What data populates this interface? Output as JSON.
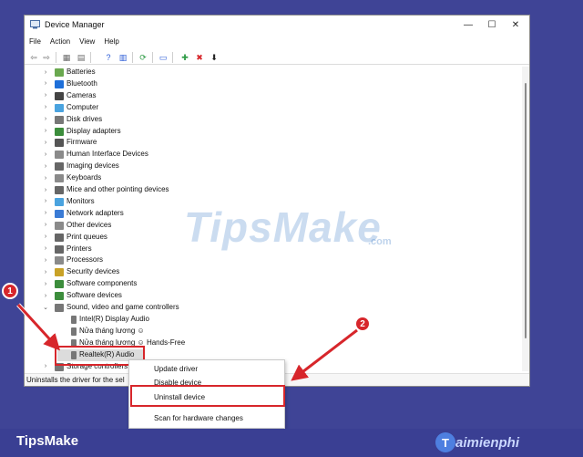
{
  "window": {
    "title": "Device Manager",
    "controls": {
      "minimize": "—",
      "maximize": "☐",
      "close": "✕"
    }
  },
  "menu": {
    "items": [
      {
        "id": "file",
        "label": "File"
      },
      {
        "id": "action",
        "label": "Action"
      },
      {
        "id": "view",
        "label": "View"
      },
      {
        "id": "help",
        "label": "Help"
      }
    ]
  },
  "toolbar": {
    "buttons": [
      {
        "id": "back",
        "glyph": "⇦",
        "color": "#6a6a6a"
      },
      {
        "id": "forward",
        "glyph": "⇨",
        "color": "#6a6a6a"
      },
      {
        "id": "properties-grid",
        "glyph": "▦",
        "color": "#6a6a6a"
      },
      {
        "id": "list-view",
        "glyph": "▤",
        "color": "#6a6a6a"
      },
      {
        "id": "help",
        "glyph": "?",
        "color": "#2a5bd7"
      },
      {
        "id": "details",
        "glyph": "▥",
        "color": "#2a5bd7"
      },
      {
        "id": "scan",
        "glyph": "⟳",
        "color": "#2e9b45"
      },
      {
        "id": "monitor",
        "glyph": "▭",
        "color": "#2a5bd7"
      },
      {
        "id": "add-driver",
        "glyph": "✚",
        "color": "#2e9b45"
      },
      {
        "id": "remove",
        "glyph": "✖",
        "color": "#d7262b"
      },
      {
        "id": "download",
        "glyph": "⬇",
        "color": "#222222"
      }
    ]
  },
  "tree": {
    "items": [
      {
        "label": "Batteries",
        "expanded": false,
        "indent": 0,
        "icon_color": "#6aa84f"
      },
      {
        "label": "Bluetooth",
        "expanded": false,
        "indent": 0,
        "icon_color": "#1e6fd9"
      },
      {
        "label": "Cameras",
        "expanded": false,
        "indent": 0,
        "icon_color": "#444444"
      },
      {
        "label": "Computer",
        "expanded": false,
        "indent": 0,
        "icon_color": "#4aa3df"
      },
      {
        "label": "Disk drives",
        "expanded": false,
        "indent": 0,
        "icon_color": "#777777"
      },
      {
        "label": "Display adapters",
        "expanded": false,
        "indent": 0,
        "icon_color": "#3c8d3c"
      },
      {
        "label": "Firmware",
        "expanded": false,
        "indent": 0,
        "icon_color": "#555555"
      },
      {
        "label": "Human Interface Devices",
        "expanded": false,
        "indent": 0,
        "icon_color": "#8a8a8a"
      },
      {
        "label": "Imaging devices",
        "expanded": false,
        "indent": 0,
        "icon_color": "#666666"
      },
      {
        "label": "Keyboards",
        "expanded": false,
        "indent": 0,
        "icon_color": "#8a8a8a"
      },
      {
        "label": "Mice and other pointing devices",
        "expanded": false,
        "indent": 0,
        "icon_color": "#666666"
      },
      {
        "label": "Monitors",
        "expanded": false,
        "indent": 0,
        "icon_color": "#4aa3df"
      },
      {
        "label": "Network adapters",
        "expanded": false,
        "indent": 0,
        "icon_color": "#3a7bd5"
      },
      {
        "label": "Other devices",
        "expanded": false,
        "indent": 0,
        "icon_color": "#8a8a8a"
      },
      {
        "label": "Print queues",
        "expanded": false,
        "indent": 0,
        "icon_color": "#666666"
      },
      {
        "label": "Printers",
        "expanded": false,
        "indent": 0,
        "icon_color": "#666666"
      },
      {
        "label": "Processors",
        "expanded": false,
        "indent": 0,
        "icon_color": "#8a8a8a"
      },
      {
        "label": "Security devices",
        "expanded": false,
        "indent": 0,
        "icon_color": "#c9a227"
      },
      {
        "label": "Software components",
        "expanded": false,
        "indent": 0,
        "icon_color": "#3c8d3c"
      },
      {
        "label": "Software devices",
        "expanded": false,
        "indent": 0,
        "icon_color": "#3c8d3c"
      },
      {
        "label": "Sound, video and game controllers",
        "expanded": true,
        "indent": 0,
        "icon_color": "#777777"
      },
      {
        "label": "Intel(R) Display Audio",
        "expanded": null,
        "indent": 1,
        "icon_color": "#777777"
      },
      {
        "label": "Nửa tháng lương ☺",
        "expanded": null,
        "indent": 1,
        "icon_color": "#777777"
      },
      {
        "label": "Nửa tháng lương ☺ Hands-Free",
        "expanded": null,
        "indent": 1,
        "icon_color": "#777777"
      },
      {
        "label": "Realtek(R) Audio",
        "expanded": null,
        "indent": 1,
        "icon_color": "#777777",
        "selected": true
      },
      {
        "label": "Storage controllers",
        "expanded": false,
        "indent": 0,
        "icon_color": "#777777"
      }
    ]
  },
  "statusbar": {
    "text": "Uninstalls the driver for the sel"
  },
  "context_menu": {
    "items": [
      {
        "id": "update-driver",
        "label": "Update driver"
      },
      {
        "id": "disable-device",
        "label": "Disable device"
      },
      {
        "id": "uninstall-device",
        "label": "Uninstall device",
        "highlighted": true
      },
      {
        "id": "scan-hardware",
        "label": "Scan for hardware changes"
      }
    ]
  },
  "annotations": {
    "marker1": "1",
    "marker2": "2",
    "color": "#d7262b"
  },
  "watermark": {
    "text": "TipsMake",
    "suffix": ".com"
  },
  "footer": {
    "left_logo": "TipsMake",
    "right_badge": "T",
    "right_text": "aimienphi"
  }
}
